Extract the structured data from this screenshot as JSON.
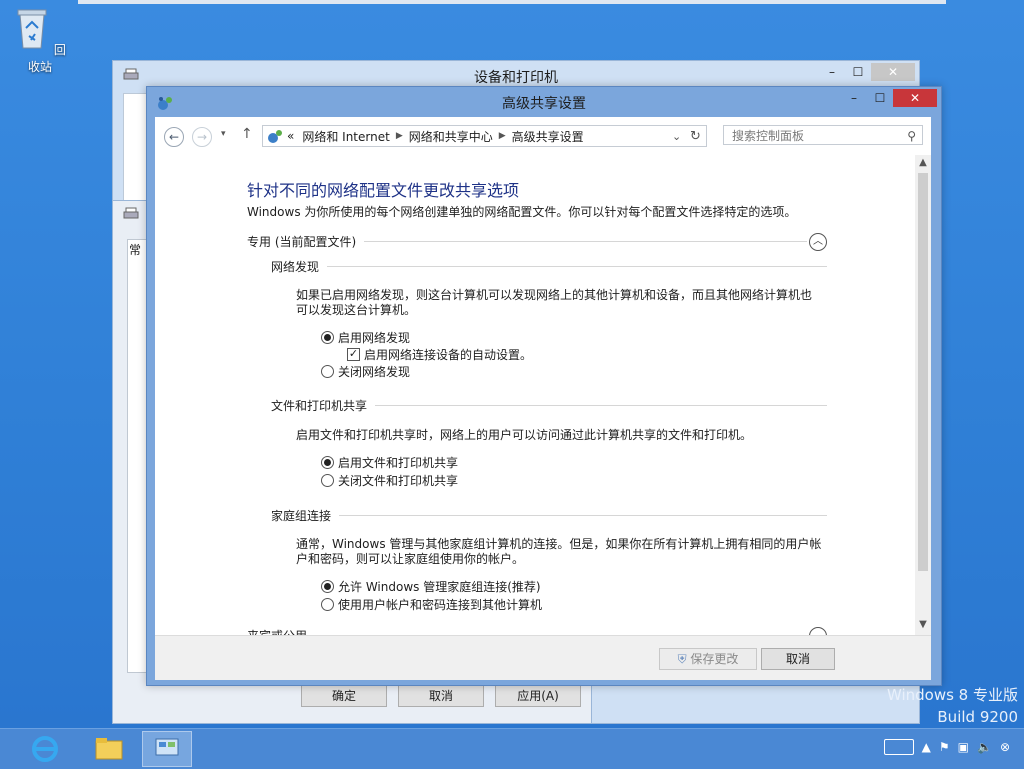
{
  "desktop": {
    "recycle_bin_label": "回收站",
    "watermark_line1": "Windows 8 专业版",
    "watermark_line2": "Build 9200"
  },
  "bg_window": {
    "title": "设备和打印机"
  },
  "prop_window": {
    "tab_label": "常",
    "ok": "确定",
    "cancel": "取消",
    "apply": "应用(A)"
  },
  "main_window": {
    "title": "高级共享设置",
    "address": {
      "overflow": "«",
      "crumbs": [
        "网络和 Internet",
        "网络和共享中心",
        "高级共享设置"
      ]
    },
    "search_placeholder": "搜索控制面板",
    "heading": "针对不同的网络配置文件更改共享选项",
    "description": "Windows 为你所使用的每个网络创建单独的网络配置文件。你可以针对每个配置文件选择特定的选项。",
    "profile_label": "专用 (当前配置文件)",
    "sections": {
      "discovery": {
        "title": "网络发现",
        "para_line1": "如果已启用网络发现，则这台计算机可以发现网络上的其他计算机和设备，而且其他网络计算机也",
        "para_line2": "可以发现这台计算机。",
        "opt_on": "启用网络发现",
        "auto_setup": "启用网络连接设备的自动设置。",
        "opt_off": "关闭网络发现"
      },
      "file_sharing": {
        "title": "文件和打印机共享",
        "para": "启用文件和打印机共享时，网络上的用户可以访问通过此计算机共享的文件和打印机。",
        "opt_on": "启用文件和打印机共享",
        "opt_off": "关闭文件和打印机共享"
      },
      "homegroup": {
        "title": "家庭组连接",
        "para_line1": "通常，Windows 管理与其他家庭组计算机的连接。但是，如果你在所有计算机上拥有相同的用户帐",
        "para_line2": "户和密码，则可以让家庭组使用你的帐户。",
        "opt_allow": "允许 Windows 管理家庭组连接(推荐)",
        "opt_user": "使用用户帐户和密码连接到其他计算机"
      }
    },
    "next_profile_label": "来宾或公用",
    "save_button": "保存更改",
    "cancel_button": "取消"
  }
}
